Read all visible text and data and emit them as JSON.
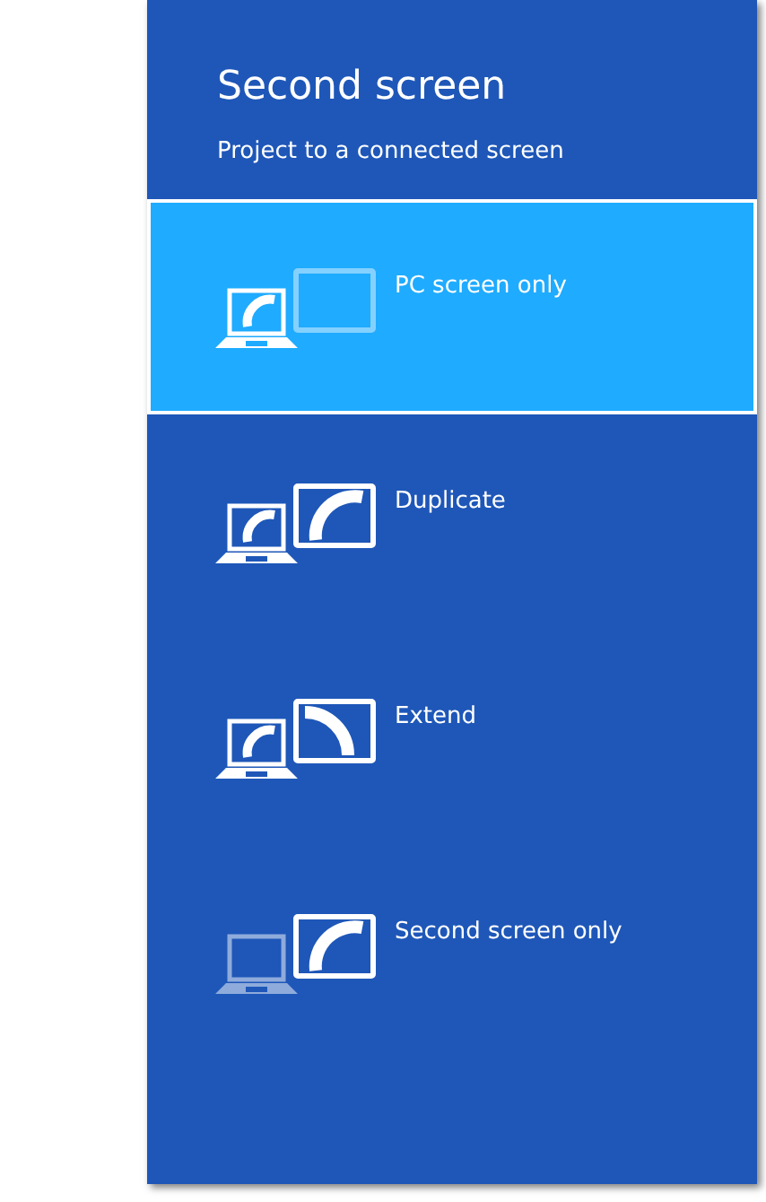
{
  "panel": {
    "title": "Second screen",
    "subtitle": "Project to a connected screen"
  },
  "options": [
    {
      "kind": "pc_only",
      "label": "PC screen only",
      "selected": true
    },
    {
      "kind": "duplicate",
      "label": "Duplicate",
      "selected": false
    },
    {
      "kind": "extend",
      "label": "Extend",
      "selected": false
    },
    {
      "kind": "second_only",
      "label": "Second screen only",
      "selected": false
    }
  ]
}
